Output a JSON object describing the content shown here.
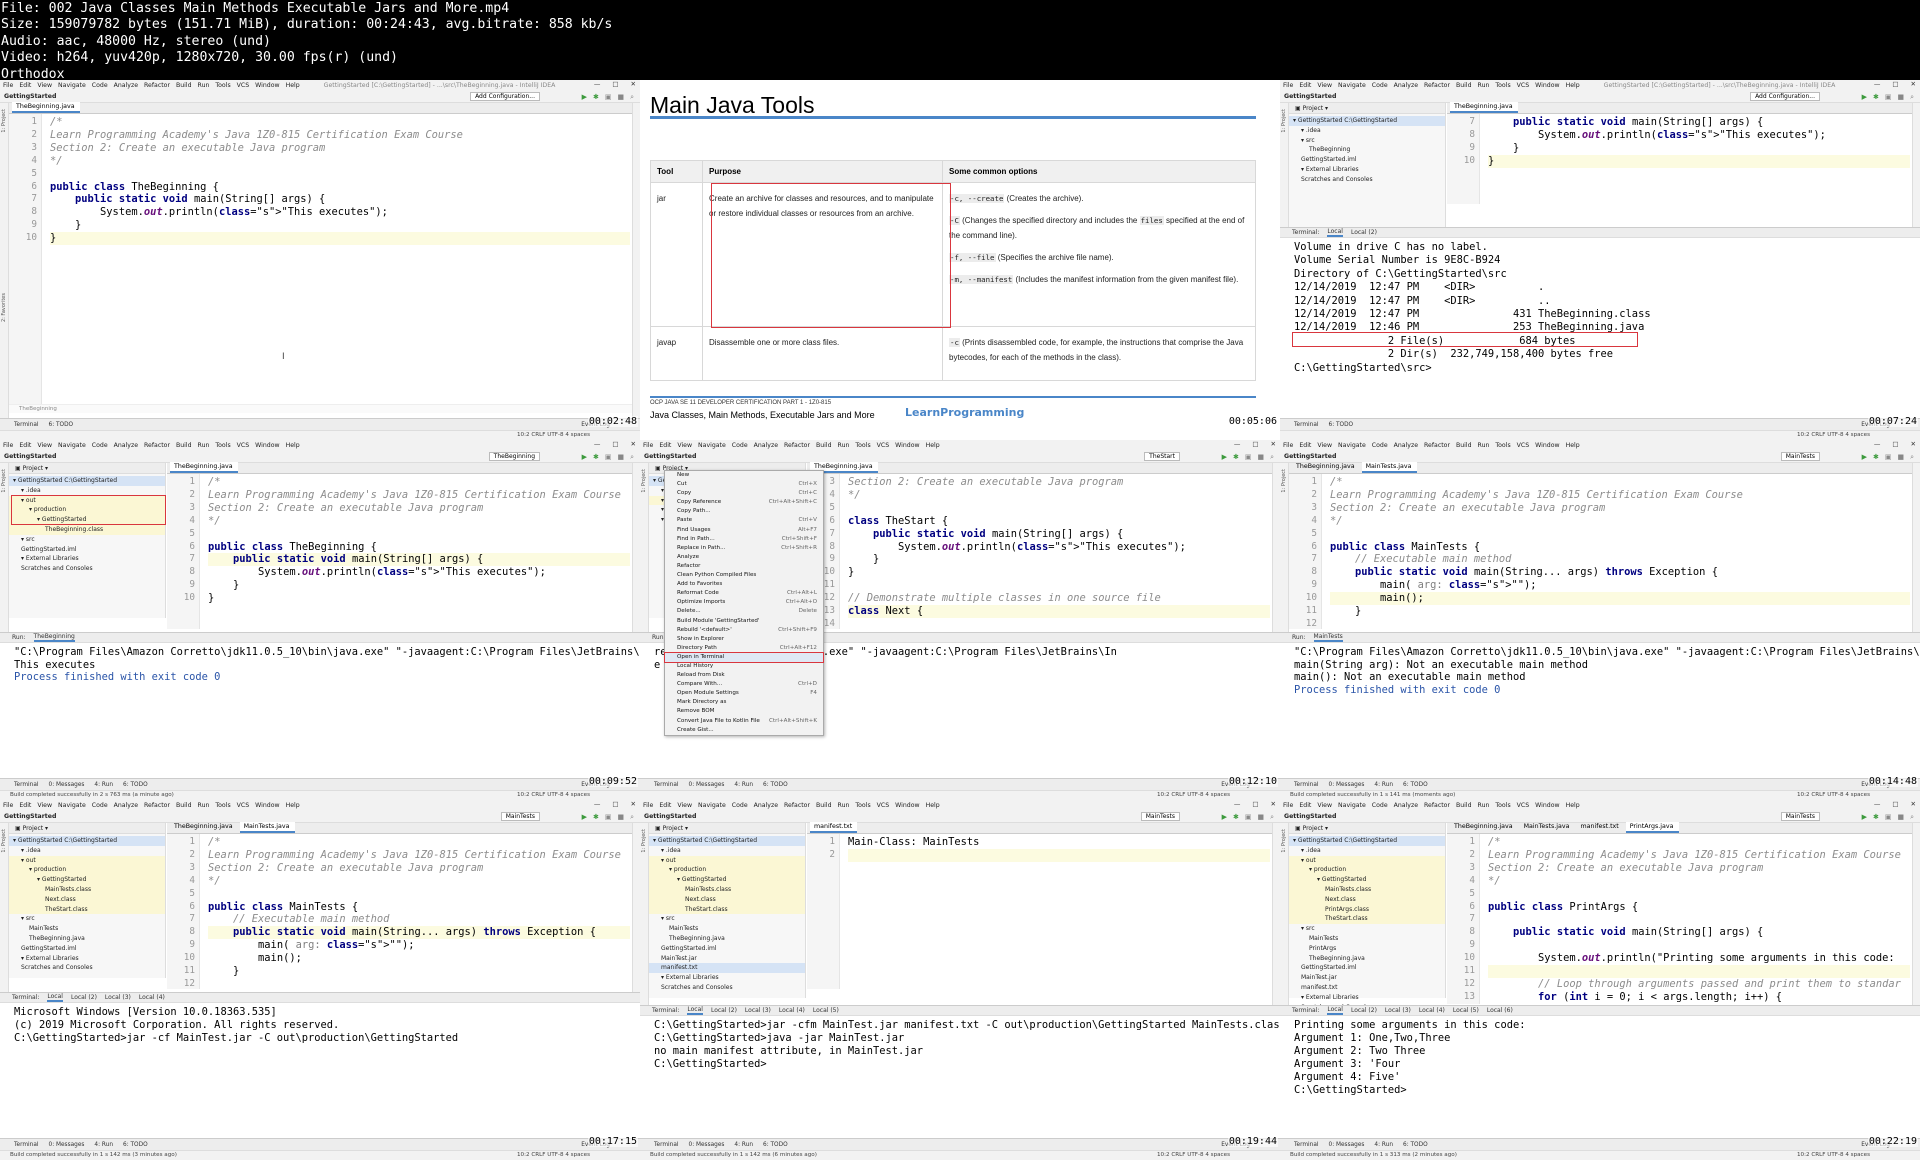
{
  "header": {
    "lines": [
      "File: 002 Java Classes Main Methods Executable Jars and More.mp4",
      "Size: 159079782 bytes (151.71 MiB), duration: 00:24:43, avg.bitrate: 858 kb/s",
      "Audio: aac, 48000 Hz, stereo (und)",
      "Video: h264, yuv420p, 1280x720, 30.00 fps(r) (und)",
      "Orthodox"
    ]
  },
  "ide": {
    "menus": [
      "File",
      "Edit",
      "View",
      "Navigate",
      "Code",
      "Analyze",
      "Refactor",
      "Build",
      "Run",
      "Tools",
      "VCS",
      "Window",
      "Help"
    ],
    "project": "GettingStarted",
    "watermark": "LearnProgramming",
    "add_config": "Add Configuration...",
    "event_log": "Event Log",
    "status_right": "10:2  CRLF  UTF-8  4 spaces"
  },
  "panes": {
    "p1": {
      "title": "GettingStarted [C:\\GettingStarted] - ...\\src\\TheBeginning.java - IntelliJ IDEA",
      "nav": [
        "GettingStarted",
        "src",
        "TheBeginning"
      ],
      "tab": "TheBeginning.java",
      "timestamp": "00:02:48",
      "crumb": "TheBeginning",
      "bottom": [
        "Terminal",
        "6: TODO"
      ],
      "lines": [
        "/*",
        "Learn Programming Academy's Java 1Z0-815 Certification Exam Course",
        "Section 2: Create an executable Java program",
        "*/",
        "",
        "public class TheBeginning {",
        "    public static void main(String[] args) {",
        "        System.out.println(\"This executes\");",
        "    }",
        "}"
      ]
    },
    "p2": {
      "title": "Main Java Tools",
      "head": [
        "Tool",
        "Purpose",
        "Some common options"
      ],
      "rows": [
        {
          "tool": "jar",
          "purpose": "Create an archive for classes and resources, and to manipulate or restore individual classes or resources from an archive.",
          "opts": [
            {
              "c": "-c, --create",
              "t": " (Creates the archive)."
            },
            {
              "c": "-C",
              "t": " (Changes the specified directory and includes the ",
              "c2": "files",
              "t2": " specified at the end of the command line)."
            },
            {
              "c": "-f, --file",
              "t": " (Specifies the archive file name)."
            },
            {
              "c": "-m, --manifest",
              "t": " (Includes the manifest information from the given manifest file)."
            }
          ]
        },
        {
          "tool": "javap",
          "purpose": "Disassemble one or more class files.",
          "opts": [
            {
              "c": "-c",
              "t": " (Prints disassembled code, for example, the instructions that comprise the Java bytecodes, for each of the methods in the class)."
            }
          ]
        }
      ],
      "footer_small": "OCP JAVA SE 11 DEVELOPER CERTIFICATION PART 1 - 1Z0-815",
      "footer": "Java Classes, Main Methods, Executable Jars and More",
      "logo": "LearnProgramming",
      "timestamp": "00:05:06"
    },
    "p3": {
      "title": "GettingStarted [C:\\GettingStarted] - ...\\src\\TheBeginning.java - IntelliJ IDEA",
      "tab": "TheBeginning.java",
      "timestamp": "00:07:24",
      "tree": [
        "GettingStarted C:\\GettingStarted",
        ".idea",
        "src",
        "TheBeginning",
        "GettingStarted.iml",
        "External Libraries",
        "Scratches and Consoles"
      ],
      "lines": [
        "    public static void main(String[] args) {",
        "        System.out.println(\"This executes\");",
        "    }",
        "}"
      ],
      "term_tabs": [
        "Terminal:",
        "Local",
        "Local (2)"
      ],
      "term": [
        "Volume in drive C has no label.",
        "Volume Serial Number is 9E8C-B924",
        "",
        "Directory of C:\\GettingStarted\\src",
        "",
        "12/14/2019  12:47 PM    <DIR>          .",
        "12/14/2019  12:47 PM    <DIR>          ..",
        "12/14/2019  12:47 PM               431 TheBeginning.class",
        "12/14/2019  12:46 PM               253 TheBeginning.java",
        "               2 File(s)            684 bytes",
        "               2 Dir(s)  232,749,158,400 bytes free",
        "",
        "C:\\GettingStarted\\src>"
      ]
    },
    "p4": {
      "timestamp": "00:09:52",
      "tab": "TheBeginning.java",
      "run_label": "TheBeginning",
      "tree": [
        "GettingStarted C:\\GettingStarted",
        ".idea",
        "out",
        "production",
        "GettingStarted",
        "TheBeginning.class",
        "src",
        "GettingStarted.iml",
        "External Libraries",
        "Scratches and Consoles"
      ],
      "lines": [
        "/*",
        "Learn Programming Academy's Java 1Z0-815 Certification Exam Course",
        "Section 2: Create an executable Java program",
        "*/",
        "",
        "public class TheBeginning {",
        "    public static void main(String[] args) {",
        "        System.out.println(\"This executes\");",
        "    }",
        "}"
      ],
      "out": [
        "\"C:\\Program Files\\Amazon Corretto\\jdk11.0.5_10\\bin\\java.exe\" \"-javaagent:C:\\Program Files\\JetBrains\\In",
        "This executes",
        "",
        "Process finished with exit code 0"
      ],
      "status": "Build completed successfully in 2 s 763 ms (a minute ago)"
    },
    "p5": {
      "timestamp": "00:12:10",
      "run_label": "TheStart",
      "lines": [
        "Section 2: Create an executable Java program",
        "*/",
        "",
        "class TheStart {",
        "    public static void main(String[] args) {",
        "        System.out.println(\"This executes\");",
        "    }",
        "}",
        "",
        "// Demonstrate multiple classes in one source file",
        "class Next {",
        "",
        "}"
      ],
      "menu": [
        [
          "New",
          ""
        ],
        [
          "Cut",
          "Ctrl+X"
        ],
        [
          "Copy",
          "Ctrl+C"
        ],
        [
          "Copy Reference",
          "Ctrl+Alt+Shift+C"
        ],
        [
          "Copy Path...",
          ""
        ],
        [
          "Paste",
          "Ctrl+V"
        ],
        [
          "Find Usages",
          "Alt+F7"
        ],
        [
          "Find in Path...",
          "Ctrl+Shift+F"
        ],
        [
          "Replace in Path...",
          "Ctrl+Shift+R"
        ],
        [
          "Analyze",
          ""
        ],
        [
          "Refactor",
          ""
        ],
        [
          "Clean Python Compiled Files",
          ""
        ],
        [
          "Add to Favorites",
          ""
        ],
        [
          "Reformat Code",
          "Ctrl+Alt+L"
        ],
        [
          "Optimize Imports",
          "Ctrl+Alt+O"
        ],
        [
          "Delete...",
          "Delete"
        ],
        [
          "Build Module 'GettingStarted'",
          ""
        ],
        [
          "Rebuild '<default>'",
          "Ctrl+Shift+F9"
        ],
        [
          "Show in Explorer",
          ""
        ],
        [
          "Directory Path",
          "Ctrl+Alt+F12"
        ],
        [
          "Open in Terminal",
          ""
        ],
        [
          "Local History",
          ""
        ],
        [
          "Reload from Disk",
          ""
        ],
        [
          "Compare With...",
          "Ctrl+D"
        ],
        [
          "Open Module Settings",
          "F4"
        ],
        [
          "Mark Directory as",
          ""
        ],
        [
          "Remove BOM",
          ""
        ],
        [
          "Convert Java File to Kotlin File",
          "Ctrl+Alt+Shift+K"
        ],
        [
          "Create Gist...",
          ""
        ]
      ],
      "out": [
        "retto\\jdk11.0.5_10\\bin\\java.exe\" \"-javaagent:C:\\Program Files\\JetBrains\\In",
        "",
        "",
        "e 0"
      ]
    },
    "p6": {
      "timestamp": "00:14:48",
      "tabs": [
        "TheBeginning.java",
        "MainTests.java"
      ],
      "run_label": "MainTests",
      "lines": [
        "/*",
        "Learn Programming Academy's Java 1Z0-815 Certification Exam Course",
        "Section 2: Create an executable Java program",
        "*/",
        "",
        "public class MainTests {",
        "    // Executable main method",
        "    public static void main(String... args) throws Exception {",
        "        main( arg: \"\");",
        "        main();",
        "    }",
        "",
        "    // Incorrect Signature, not an executable main",
        "    public static void main(String arg) {"
      ],
      "out": [
        "\"C:\\Program Files\\Amazon Corretto\\jdk11.0.5_10\\bin\\java.exe\" \"-javaagent:C:\\Program Files\\JetBrains\\In",
        "main(String arg): Not an executable main method",
        "main(): Not an executable main method",
        "",
        "Process finished with exit code 0"
      ],
      "status": "Build completed successfully in 1 s 141 ms (moments ago)"
    },
    "p7": {
      "timestamp": "00:17:15",
      "tabs": [
        "TheBeginning.java",
        "MainTests.java"
      ],
      "tree": [
        "GettingStarted C:\\GettingStarted",
        ".idea",
        "out",
        "production",
        "GettingStarted",
        "MainTests.class",
        "Next.class",
        "TheStart.class",
        "src",
        "MainTests",
        "TheBeginning.java",
        "GettingStarted.iml",
        "External Libraries",
        "Scratches and Consoles"
      ],
      "lines": [
        "/*",
        "Learn Programming Academy's Java 1Z0-815 Certification Exam Course",
        "Section 2: Create an executable Java program",
        "*/",
        "",
        "public class MainTests {",
        "    // Executable main method",
        "    public static void main(String... args) throws Exception {",
        "        main( arg: \"\");",
        "        main();",
        "    }",
        "",
        "    // Incorrect Signature, not an executable main"
      ],
      "term": [
        "Microsoft Windows [Version 10.0.18363.535]",
        "(c) 2019 Microsoft Corporation. All rights reserved.",
        "",
        "C:\\GettingStarted>jar -cf MainTest.jar -C out\\production\\GettingStarted"
      ],
      "status": "Build completed successfully in 1 s 142 ms (3 minutes ago)"
    },
    "p8": {
      "timestamp": "00:19:44",
      "tab": "manifest.txt",
      "tree": [
        "GettingStarted C:\\GettingStarted",
        ".idea",
        "out",
        "production",
        "GettingStarted",
        "MainTests.class",
        "Next.class",
        "TheStart.class",
        "src",
        "MainTests",
        "TheBeginning.java",
        "GettingStarted.iml",
        "MainTest.jar",
        "manifest.txt",
        "External Libraries",
        "Scratches and Consoles"
      ],
      "lines": [
        "Main-Class: MainTests",
        ""
      ],
      "term": [
        "C:\\GettingStarted>jar -cfm MainTest.jar manifest.txt -C out\\production\\GettingStarted MainTests.class",
        "",
        "",
        "C:\\GettingStarted>java -jar MainTest.jar",
        "no main manifest attribute, in MainTest.jar",
        "",
        "C:\\GettingStarted>"
      ],
      "status": "Build completed successfully in 1 s 142 ms (6 minutes ago)"
    },
    "p9": {
      "timestamp": "00:22:19",
      "tabs": [
        "TheBeginning.java",
        "MainTests.java",
        "manifest.txt",
        "PrintArgs.java"
      ],
      "tree": [
        "GettingStarted C:\\GettingStarted",
        ".idea",
        "out",
        "production",
        "GettingStarted",
        "MainTests.class",
        "Next.class",
        "PrintArgs.class",
        "TheStart.class",
        "src",
        "MainTests",
        "PrintArgs",
        "TheBeginning.java",
        "GettingStarted.iml",
        "MainTest.jar",
        "manifest.txt",
        "External Libraries",
        "Scratches and Consoles"
      ],
      "lines": [
        "/*",
        "Learn Programming Academy's Java 1Z0-815 Certification Exam Course",
        "Section 2: Create an executable Java program",
        "*/",
        "",
        "public class PrintArgs {",
        "",
        "    public static void main(String[] args) {",
        "",
        "        System.out.println(\"Printing some arguments in this code:",
        "",
        "        // Loop through arguments passed and print them to standar",
        "        for (int i = 0; i < args.length; i++) {"
      ],
      "term": [
        "Printing some arguments in this code:",
        "Argument 1: One,Two,Three",
        "Argument 2: Two Three",
        "Argument 3: 'Four",
        "Argument 4: Five'",
        "",
        "C:\\GettingStarted>"
      ],
      "status": "Build completed successfully in 1 s 313 ms (2 minutes ago)"
    }
  }
}
